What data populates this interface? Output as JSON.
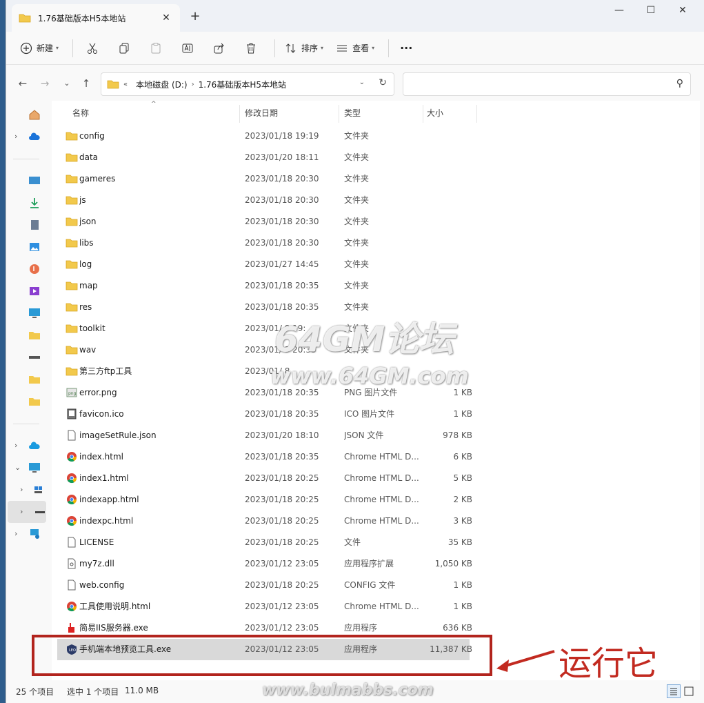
{
  "tab": {
    "title": "1.76基础版本H5本地站",
    "close": "✕"
  },
  "window": {
    "new_tab": "+",
    "minimize": "—",
    "maximize": "☐",
    "close": "✕"
  },
  "toolbar": {
    "new_label": "新建",
    "sort_label": "排序",
    "view_label": "查看",
    "more": "···"
  },
  "address": {
    "prefix": "«",
    "crumbs": [
      "本地磁盘 (D:)",
      "1.76基础版本H5本地站"
    ],
    "sep": "›"
  },
  "search": {
    "placeholder": ""
  },
  "columns": {
    "name": "名称",
    "date": "修改日期",
    "type": "类型",
    "size": "大小"
  },
  "files": [
    {
      "name": "config",
      "date": "2023/01/18 19:19",
      "type": "文件夹",
      "size": "",
      "icon": "folder"
    },
    {
      "name": "data",
      "date": "2023/01/20 18:11",
      "type": "文件夹",
      "size": "",
      "icon": "folder"
    },
    {
      "name": "gameres",
      "date": "2023/01/18 20:30",
      "type": "文件夹",
      "size": "",
      "icon": "folder"
    },
    {
      "name": "js",
      "date": "2023/01/18 20:30",
      "type": "文件夹",
      "size": "",
      "icon": "folder"
    },
    {
      "name": "json",
      "date": "2023/01/18 20:30",
      "type": "文件夹",
      "size": "",
      "icon": "folder"
    },
    {
      "name": "libs",
      "date": "2023/01/18 20:30",
      "type": "文件夹",
      "size": "",
      "icon": "folder"
    },
    {
      "name": "log",
      "date": "2023/01/27 14:45",
      "type": "文件夹",
      "size": "",
      "icon": "folder"
    },
    {
      "name": "map",
      "date": "2023/01/18 20:35",
      "type": "文件夹",
      "size": "",
      "icon": "folder"
    },
    {
      "name": "res",
      "date": "2023/01/18 20:35",
      "type": "文件夹",
      "size": "",
      "icon": "folder"
    },
    {
      "name": "toolkit",
      "date": "2023/01/ 8 19:",
      "type": "文件夹",
      "size": "",
      "icon": "folder"
    },
    {
      "name": "wav",
      "date": "2023/01/ 3 20:35",
      "type": "文件夹",
      "size": "",
      "icon": "folder"
    },
    {
      "name": "第三方ftp工具",
      "date": "2023/01/ 8",
      "type": "",
      "size": "",
      "icon": "folder"
    },
    {
      "name": "error.png",
      "date": "2023/01/18 20:35",
      "type": "PNG 图片文件",
      "size": "1 KB",
      "icon": "png"
    },
    {
      "name": "favicon.ico",
      "date": "2023/01/18 20:35",
      "type": "ICO 图片文件",
      "size": "1 KB",
      "icon": "ico"
    },
    {
      "name": "imageSetRule.json",
      "date": "2023/01/20 18:10",
      "type": "JSON 文件",
      "size": "978 KB",
      "icon": "file"
    },
    {
      "name": "index.html",
      "date": "2023/01/18 20:35",
      "type": "Chrome HTML D...",
      "size": "6 KB",
      "icon": "chrome"
    },
    {
      "name": "index1.html",
      "date": "2023/01/18 20:25",
      "type": "Chrome HTML D...",
      "size": "5 KB",
      "icon": "chrome"
    },
    {
      "name": "indexapp.html",
      "date": "2023/01/18 20:25",
      "type": "Chrome HTML D...",
      "size": "2 KB",
      "icon": "chrome"
    },
    {
      "name": "indexpc.html",
      "date": "2023/01/18 20:25",
      "type": "Chrome HTML D...",
      "size": "3 KB",
      "icon": "chrome"
    },
    {
      "name": "LICENSE",
      "date": "2023/01/18 20:25",
      "type": "文件",
      "size": "35 KB",
      "icon": "file"
    },
    {
      "name": "my7z.dll",
      "date": "2023/01/12 23:05",
      "type": "应用程序扩展",
      "size": "1,050 KB",
      "icon": "dll"
    },
    {
      "name": "web.config",
      "date": "2023/01/18 20:25",
      "type": "CONFIG 文件",
      "size": "1 KB",
      "icon": "file"
    },
    {
      "name": "工具使用说明.html",
      "date": "2023/01/12 23:05",
      "type": "Chrome HTML D...",
      "size": "1 KB",
      "icon": "chrome"
    },
    {
      "name": "简易IIS服务器.exe",
      "date": "2023/01/12 23:05",
      "type": "应用程序",
      "size": "636 KB",
      "icon": "exe-red"
    },
    {
      "name": "手机端本地预览工具.exe",
      "date": "2023/01/12 23:05",
      "type": "应用程序",
      "size": "11,387 KB",
      "icon": "exe-shield",
      "selected": true
    }
  ],
  "status": {
    "count": "25 个项目",
    "selected": "选中 1 个项目",
    "size": "11.0 MB"
  },
  "annotation": {
    "text": "运行它"
  },
  "watermarks": {
    "w1": "64GM论坛",
    "w2": "www.64GM.com",
    "w3": "www.bulmabbs.com"
  },
  "colors": {
    "folder": "#f2c94c",
    "accent": "#0067c0",
    "annotation": "#c22a20"
  }
}
